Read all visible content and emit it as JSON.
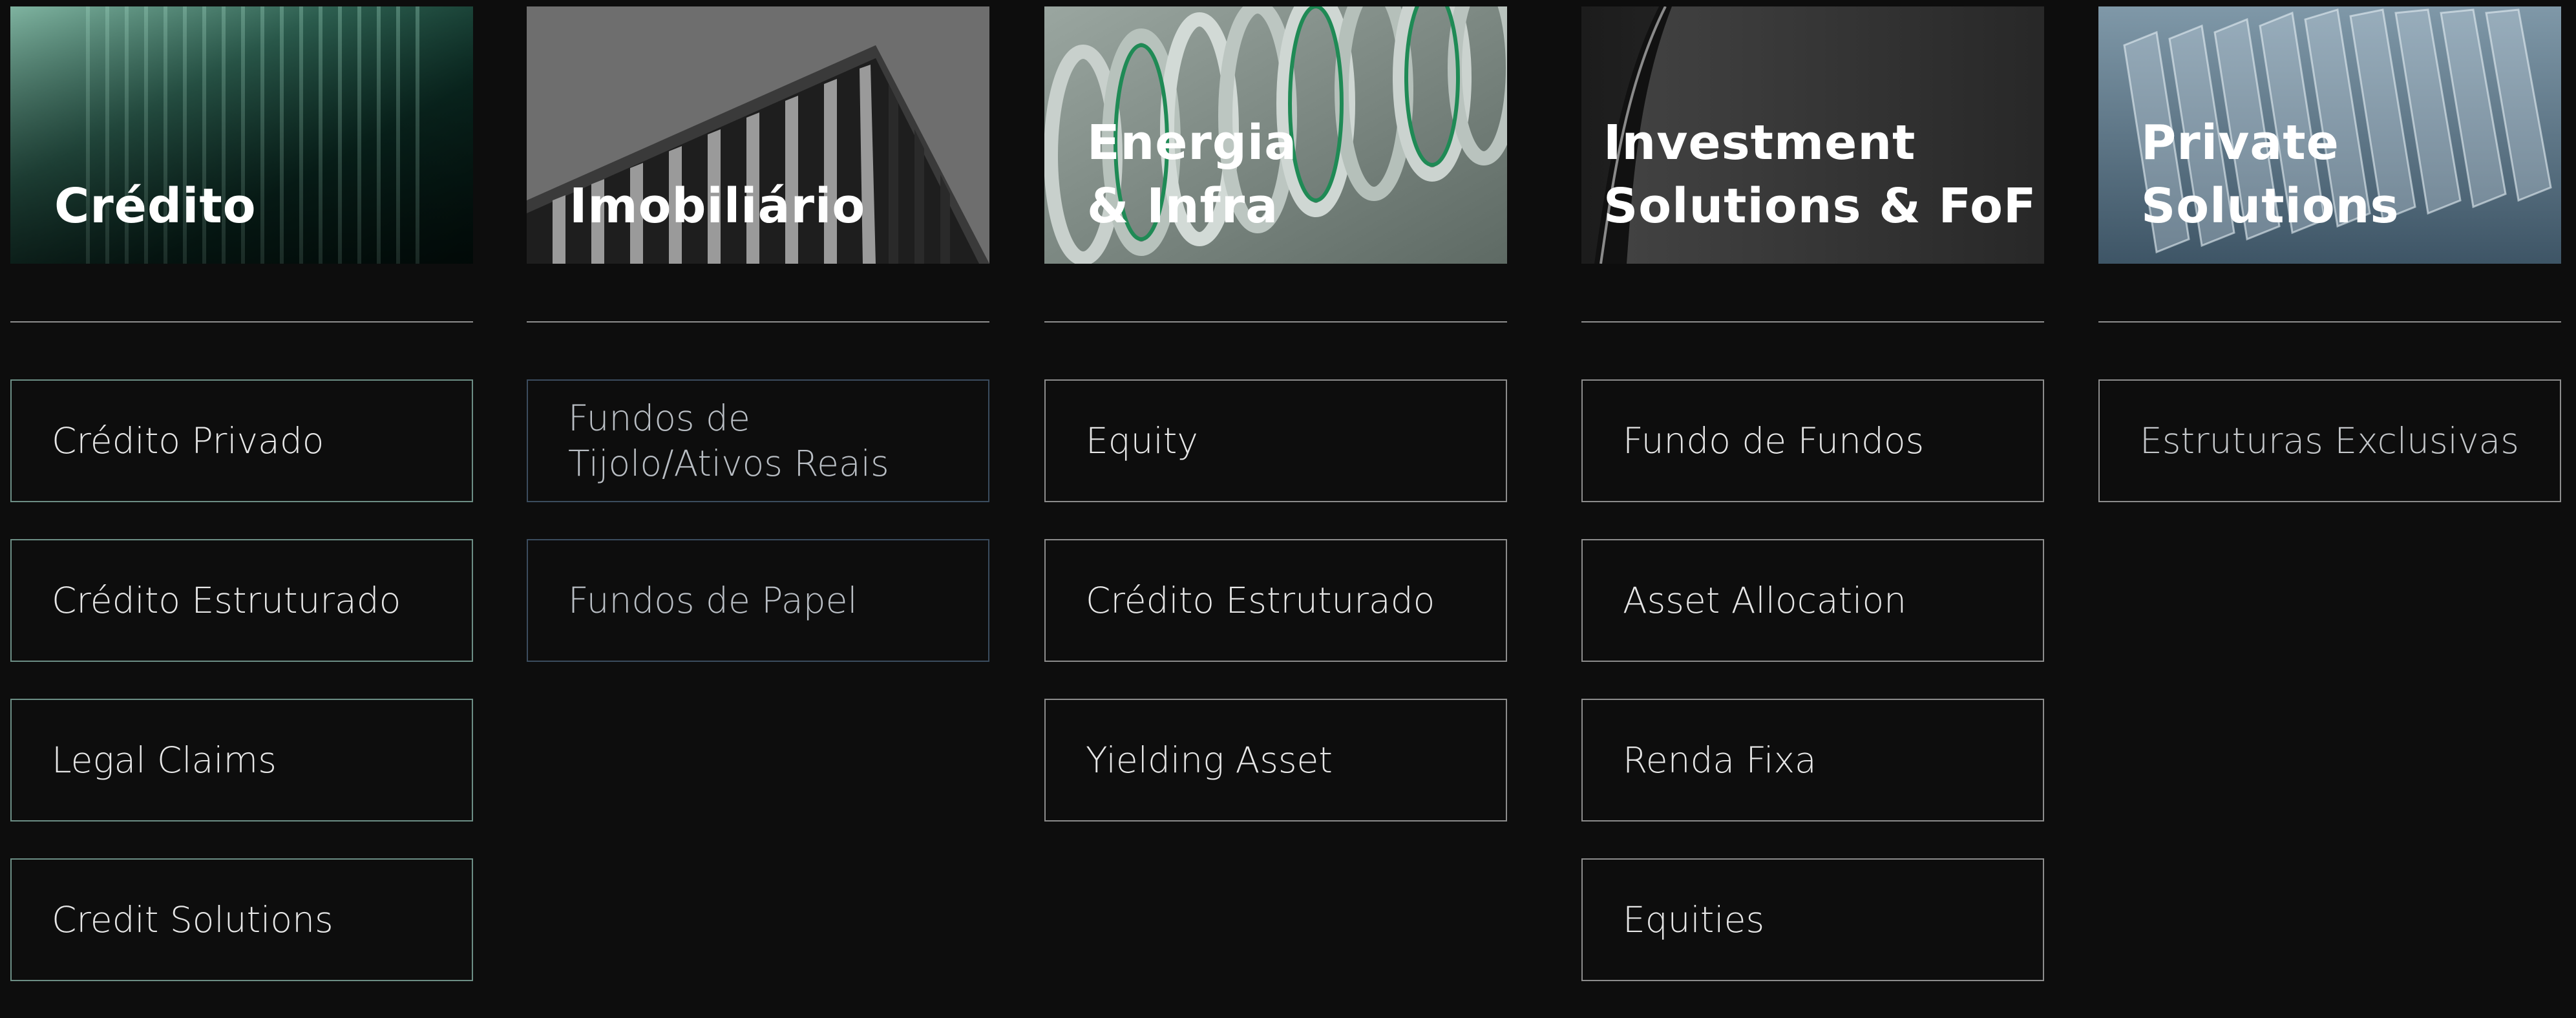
{
  "categories": [
    {
      "title_lines": [
        "Crédito"
      ],
      "items": [
        {
          "label": "Crédito Privado"
        },
        {
          "label": "Crédito Estruturado"
        },
        {
          "label": "Legal Claims"
        },
        {
          "label": "Credit Solutions"
        }
      ]
    },
    {
      "title_lines": [
        "Imobiliário"
      ],
      "items": [
        {
          "label": "Fundos de\nTijolo/Ativos Reais"
        },
        {
          "label": "Fundos de Papel"
        }
      ]
    },
    {
      "title_lines": [
        "Energia",
        "& Infra"
      ],
      "items": [
        {
          "label": "Equity"
        },
        {
          "label": "Crédito Estruturado"
        },
        {
          "label": "Yielding Asset"
        }
      ]
    },
    {
      "title_lines": [
        "Investment",
        "Solutions & FoF"
      ],
      "items": [
        {
          "label": "Fundo de Fundos"
        },
        {
          "label": "Asset Allocation"
        },
        {
          "label": "Renda Fixa"
        },
        {
          "label": "Equities"
        }
      ]
    },
    {
      "title_lines": [
        "Private",
        "Solutions"
      ],
      "items": [
        {
          "label": "Estruturas Exclusivas"
        }
      ]
    }
  ],
  "colors": {
    "background": "#0d0d0d",
    "text": "#ffffff",
    "accent_green": "#0b3a2c"
  }
}
